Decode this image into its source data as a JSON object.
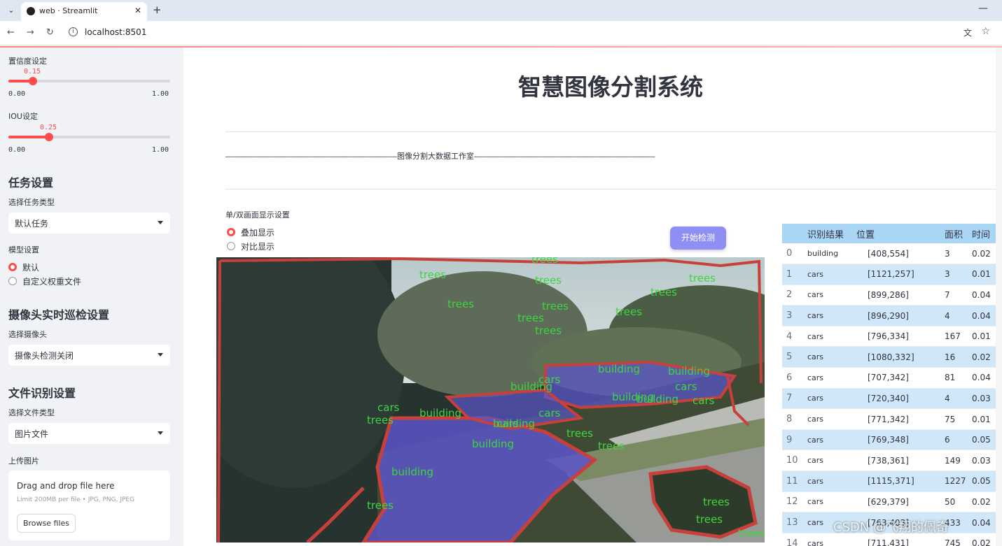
{
  "browser": {
    "tab_title": "web · Streamlit",
    "url": "localhost:8501"
  },
  "sidebar": {
    "confidence": {
      "label": "置信度设定",
      "value": "0.15",
      "value_fraction": 0.15,
      "min": "0.00",
      "max": "1.00"
    },
    "iou": {
      "label": "IOU设定",
      "value": "0.25",
      "value_fraction": 0.25,
      "min": "0.00",
      "max": "1.00"
    },
    "task_section": "任务设置",
    "task_type_label": "选择任务类型",
    "task_type_value": "默认任务",
    "model_label": "模型设置",
    "model_options": [
      "默认",
      "自定义权重文件"
    ],
    "camera_section": "摄像头实时巡检设置",
    "camera_label": "选择摄像头",
    "camera_value": "摄像头检测关闭",
    "file_section": "文件识别设置",
    "file_type_label": "选择文件类型",
    "file_type_value": "图片文件",
    "upload_label": "上传图片",
    "upload_title": "Drag and drop file here",
    "upload_sub": "Limit 200MB per file • JPG, PNG, JPEG",
    "browse_label": "Browse files"
  },
  "main": {
    "title": "智慧图像分割系统",
    "subtitle": "—————————————————————————————————————图像分割大数据工作室———————————————————————————————————————",
    "display_label": "单/双画面显示设置",
    "display_options": [
      "叠加显示",
      "对比显示"
    ],
    "start_button": "开始检测",
    "overlay_labels": [
      "building",
      "cars",
      "trees"
    ]
  },
  "table": {
    "headers": [
      "",
      "识别结果",
      "位置",
      "面积",
      "时间"
    ],
    "rows": [
      [
        "0",
        "building",
        "[408,554]",
        "3",
        "0.02"
      ],
      [
        "1",
        "cars",
        "[1121,257]",
        "3",
        "0.01"
      ],
      [
        "2",
        "cars",
        "[899,286]",
        "7",
        "0.04"
      ],
      [
        "3",
        "cars",
        "[896,290]",
        "4",
        "0.04"
      ],
      [
        "4",
        "cars",
        "[796,334]",
        "167",
        "0.01"
      ],
      [
        "5",
        "cars",
        "[1080,332]",
        "16",
        "0.02"
      ],
      [
        "6",
        "cars",
        "[707,342]",
        "81",
        "0.04"
      ],
      [
        "7",
        "cars",
        "[720,340]",
        "4",
        "0.03"
      ],
      [
        "8",
        "cars",
        "[771,342]",
        "75",
        "0.01"
      ],
      [
        "9",
        "cars",
        "[769,348]",
        "6",
        "0.05"
      ],
      [
        "10",
        "cars",
        "[738,361]",
        "149",
        "0.03"
      ],
      [
        "11",
        "cars",
        "[1115,371]",
        "1227",
        "0.05"
      ],
      [
        "12",
        "cars",
        "[629,379]",
        "50",
        "0.02"
      ],
      [
        "13",
        "cars",
        "[763,403]",
        "433",
        "0.04"
      ],
      [
        "14",
        "cars",
        "[711,431]",
        "745",
        "0.02"
      ]
    ]
  },
  "watermark": "CSDN @飞翔的佩奇",
  "colors": {
    "accent": "#ff4b4b",
    "button": "#8d8ff5",
    "mask": "#5a55c8",
    "label": "#3fd43f",
    "contour": "#c8403c"
  }
}
